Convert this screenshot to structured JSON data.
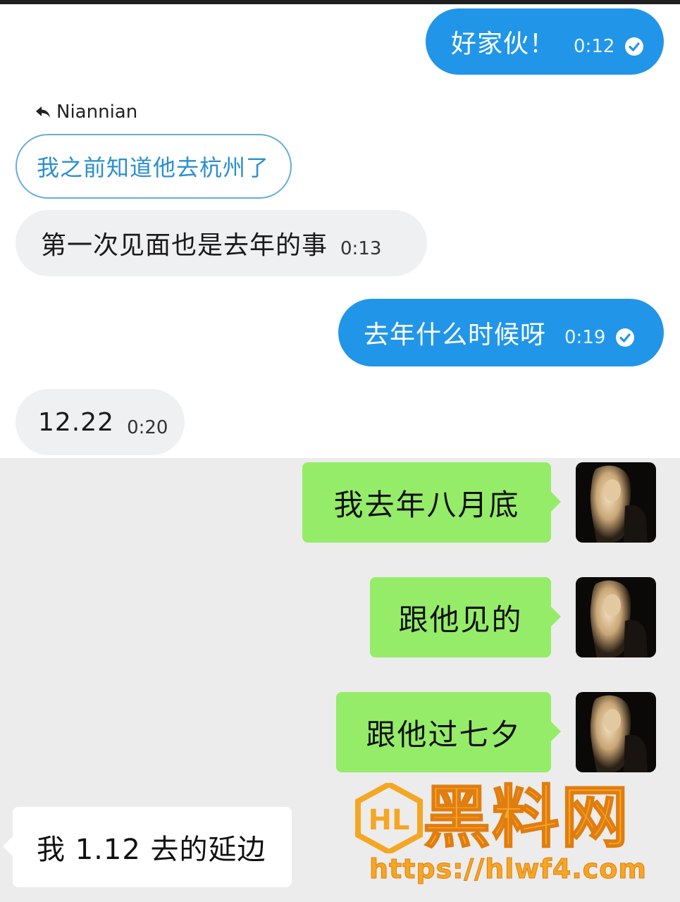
{
  "telegram": {
    "messages": [
      {
        "text": "好家伙！",
        "time": "0:12"
      },
      {
        "text": "第一次见面也是去年的事",
        "time": "0:13"
      },
      {
        "text": "去年什么时候呀",
        "time": "0:19"
      },
      {
        "text": "12.22",
        "time": "0:20"
      }
    ],
    "reply": {
      "author": "Niannian",
      "quoted_text": "我之前知道他去杭州了"
    }
  },
  "wechat": {
    "outgoing": [
      {
        "text": "我去年八月底"
      },
      {
        "text": "跟他见的"
      },
      {
        "text": "跟他过七夕"
      }
    ],
    "incoming": [
      {
        "text": "我 1.12 去的延边"
      }
    ]
  },
  "watermark": {
    "title": "黑料网",
    "url": "https://hlwf4.com",
    "logo_letters": "HL"
  },
  "colors": {
    "telegram_outgoing": "#2196e8",
    "telegram_incoming": "#eef0f2",
    "wechat_outgoing": "#95ec69",
    "wechat_incoming": "#ffffff",
    "watermark": "#f5a623"
  }
}
